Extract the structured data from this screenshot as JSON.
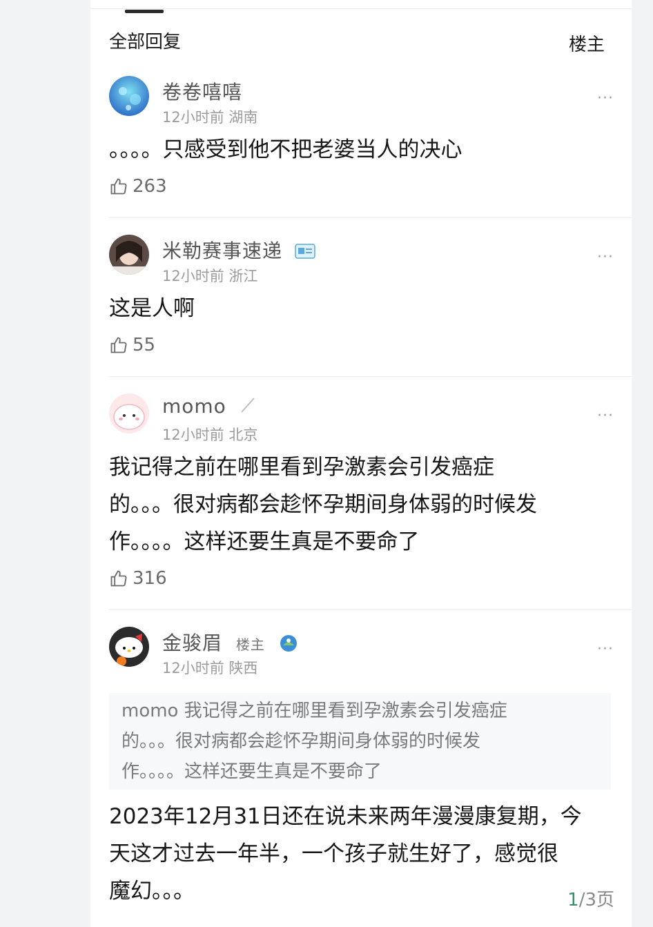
{
  "header": {
    "title": "全部回复",
    "owner_filter": "楼主"
  },
  "comments": [
    {
      "name": "卷卷嘻嘻",
      "time": "12小时前",
      "location": "湖南",
      "text": "。。。。只感受到他不把老婆当人的决心",
      "likes": "263"
    },
    {
      "name": "米勒赛事速递",
      "time": "12小时前",
      "location": "浙江",
      "text": "这是人啊",
      "likes": "55"
    },
    {
      "name": "momo",
      "time": "12小时前",
      "location": "北京",
      "text_lines": [
        "我记得之前在哪里看到孕激素会引发癌症",
        "的。。。很对病都会趁怀孕期间身体弱的时候发",
        "作。。。。这样还要生真是不要命了"
      ],
      "likes": "316"
    },
    {
      "name": "金骏眉",
      "badge": "楼主",
      "time": "12小时前",
      "location": "陕西",
      "quote_lines": [
        "momo 我记得之前在哪里看到孕激素会引发癌症",
        "的。。。很对病都会趁怀孕期间身体弱的时候发",
        "作。。。。这样还要生真是不要命了"
      ],
      "text_lines": [
        "2023年12月31日还在说未来两年漫漫康复期，今",
        "天这才过去一年半，一个孩子就生好了，感觉很",
        "魔幻。。。"
      ]
    }
  ],
  "more_label": "···",
  "pagination": {
    "current": "1",
    "rest": "/3页"
  },
  "colors": {
    "accent": "#3a8f6b",
    "text": "#161616",
    "muted": "#9b9b9b"
  }
}
